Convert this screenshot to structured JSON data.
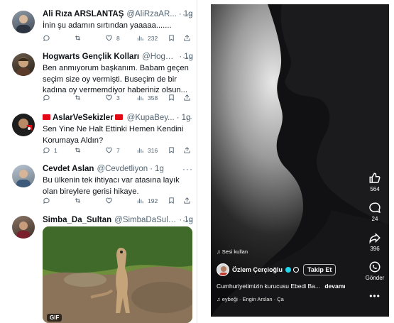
{
  "tweets": [
    {
      "name": "Ali Rıza ARSLANTAŞ",
      "handle": "@AliRzaAR...",
      "time": "1g",
      "text": "İnin şu adamın sırtından yaaaaa.......",
      "replies": "",
      "retweets": "",
      "likes": "8",
      "views": "232"
    },
    {
      "name": "Hogwarts Gençlik Kolları",
      "handle": "@Hogw...",
      "time": "1g",
      "text": "Ben anmıyorum başkanım. Babam geçen seçim size oy vermişti. Buseçim de bir kadına oy vermemdiyor haberiniz olsun...",
      "replies": "",
      "retweets": "",
      "likes": "3",
      "views": "358"
    },
    {
      "name": "AslarVeSekizler",
      "handle": "@KupaBey...",
      "time": "1g",
      "text": "Sen Yine Ne Halt Ettinki Hemen Kendini Korumaya Aldın?",
      "replies": "1",
      "retweets": "",
      "likes": "7",
      "views": "316"
    },
    {
      "name": "Cevdet Aslan",
      "handle": "@Cevdetliyon",
      "time": "1g",
      "text": "Bu ülkenin tek ihtiyacı var atasına layık olan bireylere gerisi hikaye.",
      "replies": "",
      "retweets": "",
      "likes": "",
      "views": "192"
    },
    {
      "name": "Simba_Da_Sultan",
      "handle": "@SimbaDaSulta...",
      "time": "1g",
      "text": "",
      "media_badge": "GIF"
    }
  ],
  "tiktok": {
    "likes": "564",
    "comments": "24",
    "shares": "396",
    "whatsapp_label": "Gönder",
    "sound_label": "Sesi kullan",
    "author": "Özlem Çerçioğlu",
    "follow_label": "Takip Et",
    "caption": "Cumhuriyetimizin kurucusu Ebedi Ba...",
    "caption_more": "devamı",
    "music_text": "eybeği · Engin Arslan · Ça"
  }
}
